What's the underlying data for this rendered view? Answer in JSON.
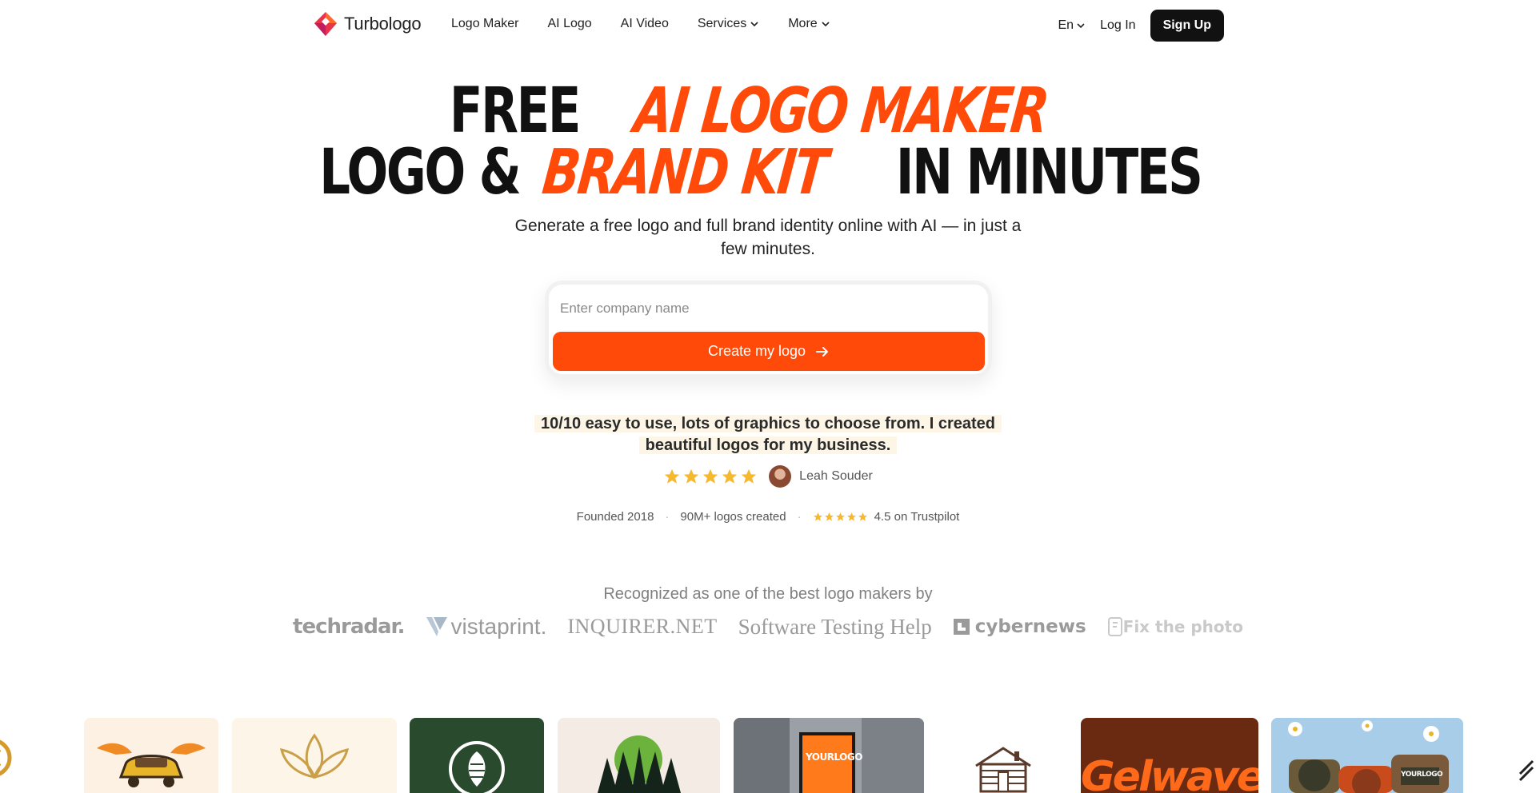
{
  "nav": {
    "brand": "Turbologo",
    "links": [
      "Logo Maker",
      "AI Logo",
      "AI Video",
      "Services",
      "More"
    ],
    "lang": "En",
    "login": "Log In",
    "signup": "Sign Up"
  },
  "hero": {
    "line1_dark": "FREE",
    "line1_accent": "AI LOGO MAKER",
    "line2_dark1": "LOGO &",
    "line2_accent": "BRAND KIT",
    "line2_dark2": "IN MINUTES",
    "subtitle": "Generate a free logo and full brand identity online with AI — in just a few minutes.",
    "input_placeholder": "Enter company name",
    "cta": "Create my logo"
  },
  "testimonial": {
    "quote": "10/10 easy to use, lots of graphics to choose from. I created beautiful logos for my business.",
    "rating_stars": 5,
    "author": "Leah Souder"
  },
  "stats": {
    "founded": "Founded 2018",
    "logos": "90M+ logos created",
    "trustpilot": "4.5 on Trustpilot"
  },
  "press": {
    "heading": "Recognized as one of the best logo makers by",
    "logos": [
      "techradar.",
      "vistaprint.",
      "INQUIRER.NET",
      "Software Testing Help",
      "cybernews",
      "Fix the photo"
    ]
  },
  "gallery": {
    "tile_texts": [
      "YOURLOGO",
      "Gelwave",
      "YOURLOGO"
    ]
  },
  "colors": {
    "accent": "#ff4a0a",
    "dark": "#111111",
    "star": "#f5b82e"
  }
}
